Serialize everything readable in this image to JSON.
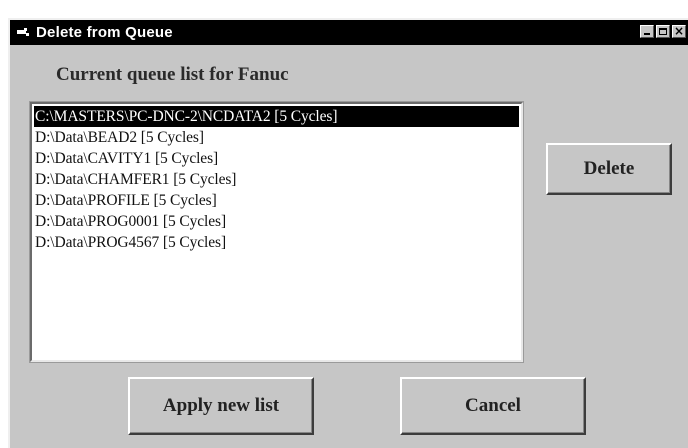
{
  "window": {
    "title": "Delete from Queue",
    "controls": {
      "minimize": "minimize",
      "maximize": "maximize",
      "close": "×"
    }
  },
  "caption": "Current queue list for Fanuc",
  "queue_list": {
    "items": [
      {
        "label": "C:\\MASTERS\\PC-DNC-2\\NCDATA2 [5 Cycles]",
        "selected": true
      },
      {
        "label": "D:\\Data\\BEAD2 [5 Cycles]",
        "selected": false
      },
      {
        "label": "D:\\Data\\CAVITY1 [5 Cycles]",
        "selected": false
      },
      {
        "label": "D:\\Data\\CHAMFER1 [5 Cycles]",
        "selected": false
      },
      {
        "label": "D:\\Data\\PROFILE [5 Cycles]",
        "selected": false
      },
      {
        "label": "D:\\Data\\PROG0001 [5 Cycles]",
        "selected": false
      },
      {
        "label": "D:\\Data\\PROG4567 [5 Cycles]",
        "selected": false
      }
    ]
  },
  "buttons": {
    "delete": "Delete",
    "apply": "Apply new list",
    "cancel": "Cancel"
  }
}
